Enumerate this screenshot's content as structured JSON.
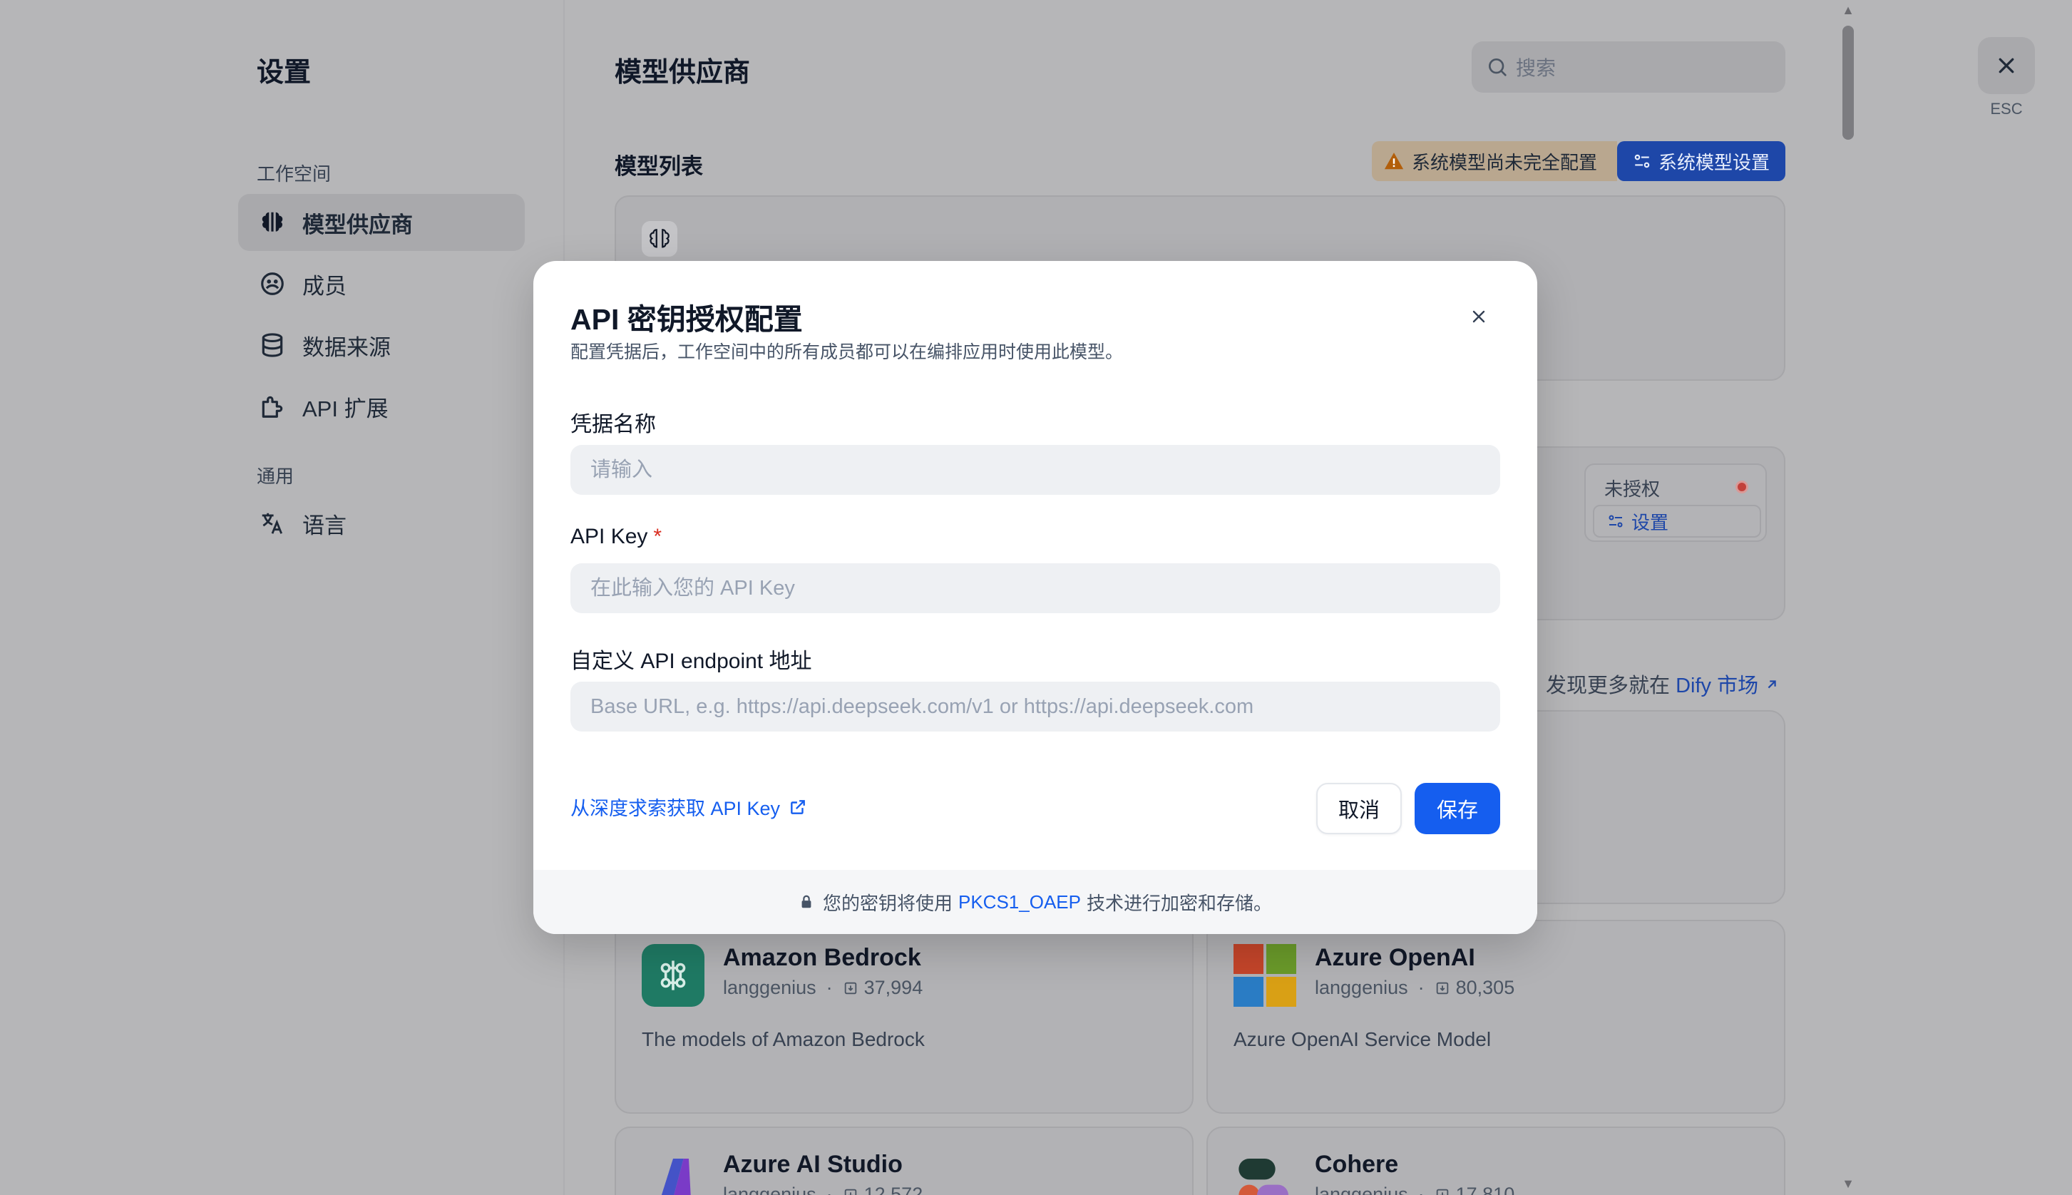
{
  "sidebar": {
    "title": "设置",
    "group_workspace": "工作空间",
    "group_general": "通用",
    "items": [
      {
        "label": "模型供应商"
      },
      {
        "label": "成员"
      },
      {
        "label": "数据来源"
      },
      {
        "label": "API 扩展"
      },
      {
        "label": "语言"
      }
    ]
  },
  "header": {
    "title": "模型供应商",
    "search_placeholder": "搜索",
    "esc_label": "ESC"
  },
  "model_list": {
    "title": "模型列表",
    "warning": "系统模型尚未完全配置",
    "system_settings_button": "系统模型设置"
  },
  "provider_status": {
    "status": "未授权",
    "settings_button": "设置"
  },
  "marketplace": {
    "prefix": "发现更多就在",
    "link": "Dify 市场"
  },
  "plugins": [
    {
      "name": "Amazon Bedrock",
      "author": "langgenius",
      "installs": "37,994",
      "desc": "The models of Amazon Bedrock"
    },
    {
      "name": "Azure OpenAI",
      "author": "langgenius",
      "installs": "80,305",
      "desc": "Azure OpenAI Service Model"
    },
    {
      "name": "Azure AI Studio",
      "author": "langgenius",
      "installs": "12,572",
      "desc": ""
    },
    {
      "name": "Cohere",
      "author": "langgenius",
      "installs": "17,810",
      "desc": ""
    }
  ],
  "modal": {
    "title": "API 密钥授权配置",
    "subtitle": "配置凭据后，工作空间中的所有成员都可以在编排应用时使用此模型。",
    "credential_name_label": "凭据名称",
    "credential_name_placeholder": "请输入",
    "credential_name_value": "",
    "api_key_label": "API Key",
    "api_key_required": "*",
    "api_key_placeholder": "在此输入您的 API Key",
    "api_key_value": "",
    "endpoint_label": "自定义 API endpoint 地址",
    "endpoint_placeholder": "Base URL, e.g. https://api.deepseek.com/v1 or https://api.deepseek.com",
    "endpoint_value": "",
    "get_key_link": "从深度求索获取 API Key",
    "cancel_button": "取消",
    "save_button": "保存",
    "footer_prefix": "您的密钥将使用",
    "footer_highlight": "PKCS1_OAEP",
    "footer_suffix": "技术进行加密和存储。"
  },
  "colors": {
    "primary": "#155eef",
    "danger": "#d92d20",
    "warning": "#f79009"
  }
}
